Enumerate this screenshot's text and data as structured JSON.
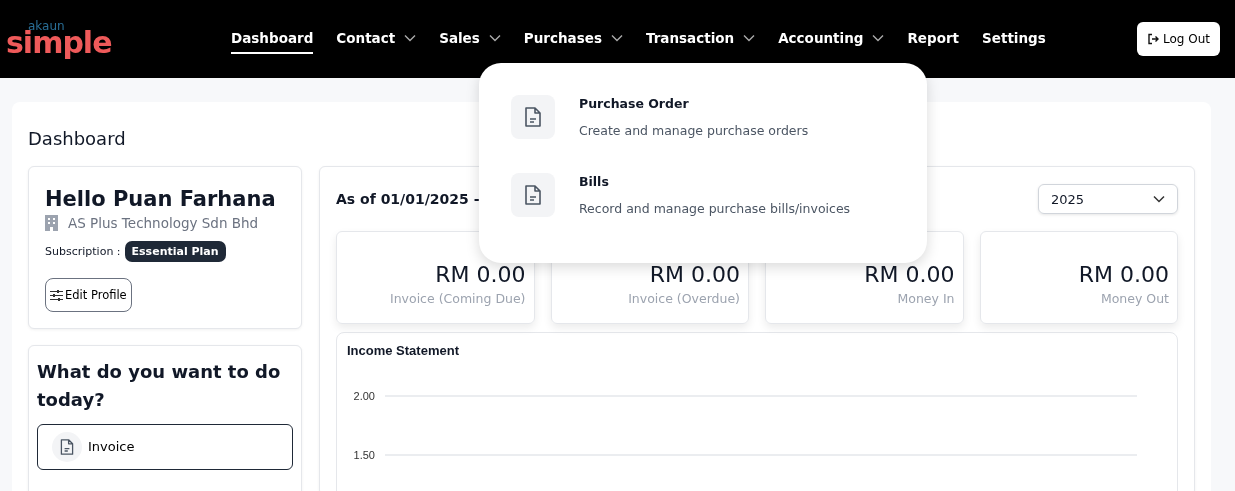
{
  "logo": {
    "top": "akaun",
    "main": "simple"
  },
  "nav": [
    {
      "label": "Dashboard",
      "selected": true,
      "dropdown": false
    },
    {
      "label": "Contact",
      "selected": false,
      "dropdown": true
    },
    {
      "label": "Sales",
      "selected": false,
      "dropdown": true
    },
    {
      "label": "Purchases",
      "selected": false,
      "dropdown": true
    },
    {
      "label": "Transaction",
      "selected": false,
      "dropdown": true
    },
    {
      "label": "Accounting",
      "selected": false,
      "dropdown": true
    },
    {
      "label": "Report",
      "selected": false,
      "dropdown": false
    },
    {
      "label": "Settings",
      "selected": false,
      "dropdown": false
    }
  ],
  "logout": "Log Out",
  "purchases_menu": [
    {
      "title": "Purchase Order",
      "description": "Create and manage purchase orders"
    },
    {
      "title": "Bills",
      "description": "Record and manage purchase bills/invoices"
    }
  ],
  "page_title": "Dashboard",
  "profile": {
    "greeting": "Hello Puan Farhana",
    "company": "AS Plus Technology Sdn Bhd",
    "subscription_label": "Subscription :",
    "plan": "Essential Plan",
    "edit": "Edit Profile"
  },
  "quick": {
    "title": "What do you want to do today?",
    "actions": [
      "Invoice"
    ]
  },
  "period": "As of 01/01/2025 -",
  "year": "2025",
  "stats": [
    {
      "amount": "RM 0.00",
      "label": "Invoice (Coming Due)"
    },
    {
      "amount": "RM 0.00",
      "label": "Invoice (Overdue)"
    },
    {
      "amount": "RM 0.00",
      "label": "Money In"
    },
    {
      "amount": "RM 0.00",
      "label": "Money Out"
    }
  ],
  "income": {
    "title": "Income Statement",
    "axis_labels": [
      "2.00",
      "1.50"
    ]
  }
}
